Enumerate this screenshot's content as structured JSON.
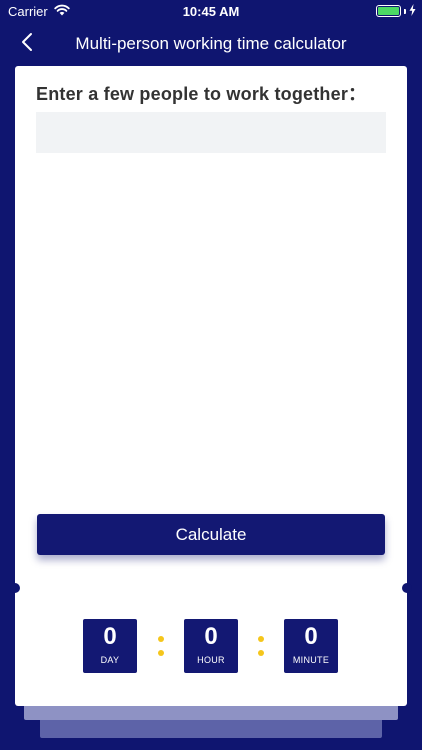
{
  "status_bar": {
    "carrier": "Carrier",
    "time": "10:45 AM"
  },
  "nav": {
    "title": "Multi-person working time calculator"
  },
  "form": {
    "prompt": "Enter a few people to work together：",
    "people_value": "",
    "calculate_label": "Calculate"
  },
  "result": {
    "day": {
      "value": "0",
      "unit": "DAY"
    },
    "hour": {
      "value": "0",
      "unit": "HOUR"
    },
    "minute": {
      "value": "0",
      "unit": "MINUTE"
    }
  },
  "colors": {
    "background": "#0f1570",
    "tile": "#131873",
    "separator": "#f5c61b",
    "battery": "#4cd964",
    "input_bg": "#f1f3f5"
  },
  "icons": {
    "back": "chevron-left-icon",
    "wifi": "wifi-icon",
    "battery": "battery-icon",
    "charging": "charging-bolt-icon"
  }
}
